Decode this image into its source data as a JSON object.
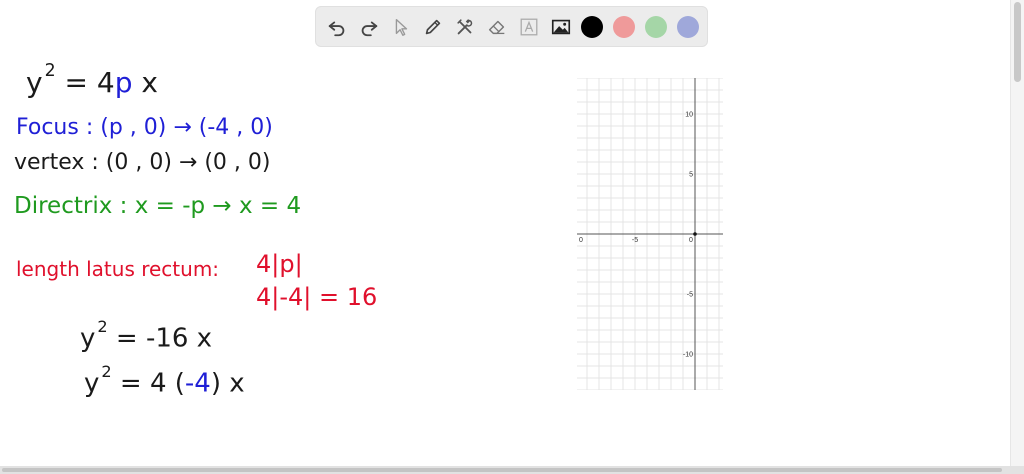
{
  "toolbar": {
    "tools": [
      "undo-icon",
      "redo-icon",
      "select-icon",
      "pen-icon",
      "tools-icon",
      "eraser-icon",
      "text-icon",
      "image-icon"
    ],
    "colors": [
      "#000000",
      "#ef9a9a",
      "#a5d6a7",
      "#9fa8da"
    ]
  },
  "notes": {
    "eq_y": "y",
    "eq_exp": "2",
    "eq_eq": "= 4",
    "eq_p": "p",
    "eq_x": " x",
    "focus": "Focus : (p , 0)  →  (-4 , 0)",
    "vertex": "vertex : (0 , 0)  →  (0 , 0)",
    "directrix": "Directrix :  x = -p  →  x = 4",
    "latus_label": "length latus rectum:",
    "latus_formula": "4|p|",
    "latus_value": "4|-4| = 16",
    "eq2_y": "y",
    "eq2_exp": "2",
    "eq2_rest": "= -16 x",
    "eq3_y": "y",
    "eq3_exp": "2",
    "eq3_pre": "= 4 (",
    "eq3_val": "-4",
    "eq3_post": ") x"
  },
  "graph": {
    "x_range": [
      0,
      -10
    ],
    "y_range": [
      -13,
      13
    ],
    "x_tick_labels": [
      "0",
      "-5",
      "0"
    ],
    "y_tick_labels": [
      "10",
      "5",
      "-5",
      "-10"
    ],
    "point": [
      0,
      0
    ]
  }
}
